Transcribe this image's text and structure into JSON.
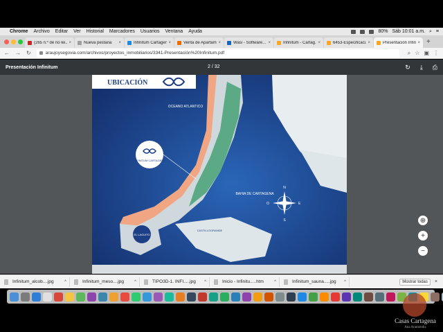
{
  "menubar": {
    "app": "Chrome",
    "items": [
      "Archivo",
      "Editar",
      "Ver",
      "Historial",
      "Marcadores",
      "Usuarios",
      "Ventana",
      "Ayuda"
    ],
    "battery": "80%",
    "clock": "Sáb 10:01 a.m."
  },
  "tabs": [
    {
      "label": "(265 n.º de no lei...",
      "color": "#c62828"
    },
    {
      "label": "Nueva pestaña",
      "color": "#9e9e9e"
    },
    {
      "label": "Infinitum Cartagen...",
      "color": "#1e88e5"
    },
    {
      "label": "Venta de Apartam...",
      "color": "#ef6c00"
    },
    {
      "label": "Wasi - Software...",
      "color": "#1565c0"
    },
    {
      "label": "Infinitum - Cartag...",
      "color": "#f9a825"
    },
    {
      "label": "6453-Especificaci...",
      "color": "#f9a825"
    },
    {
      "label": "Presentación Infini...",
      "color": "#f9a825",
      "active": true
    }
  ],
  "address": {
    "url": "araujoysegovia.com/archivos/proyectos_inmobiliarios/3341-Presentación%20Infinitum.pdf"
  },
  "pdf": {
    "title": "Presentación Infinitum",
    "page_indicator": "2 / 32"
  },
  "map": {
    "heading": "UBICACIÓN",
    "ocean_label": "OCEANO ATLANTICO",
    "bay_label": "BAHIA DE CARTAGENA",
    "logo_label": "INFINITUM CARTAGENA",
    "laguito_label": "EL LAGUITO",
    "castillo_label": "CASTILLOGRANDE",
    "compass_n": "N",
    "compass_s": "S",
    "compass_e": "E",
    "compass_o": "O",
    "colors": {
      "ocean": "#1d3f86",
      "land": "#e8eef0",
      "beach": "#f1a683",
      "park": "#3f9e70"
    }
  },
  "downloads": {
    "items": [
      "Infinitum_alcob....jpg",
      "Infinitum_meso....jpg",
      "TIPO3D-1. INFI.....jpg",
      "Inicio - Infinitu.....htm",
      "Infinitum_sauna.....jpg"
    ],
    "show_all": "Mostrar todas"
  },
  "watermark": {
    "name": "Casas Cartagena",
    "sub": "Ana Aramendiz"
  }
}
